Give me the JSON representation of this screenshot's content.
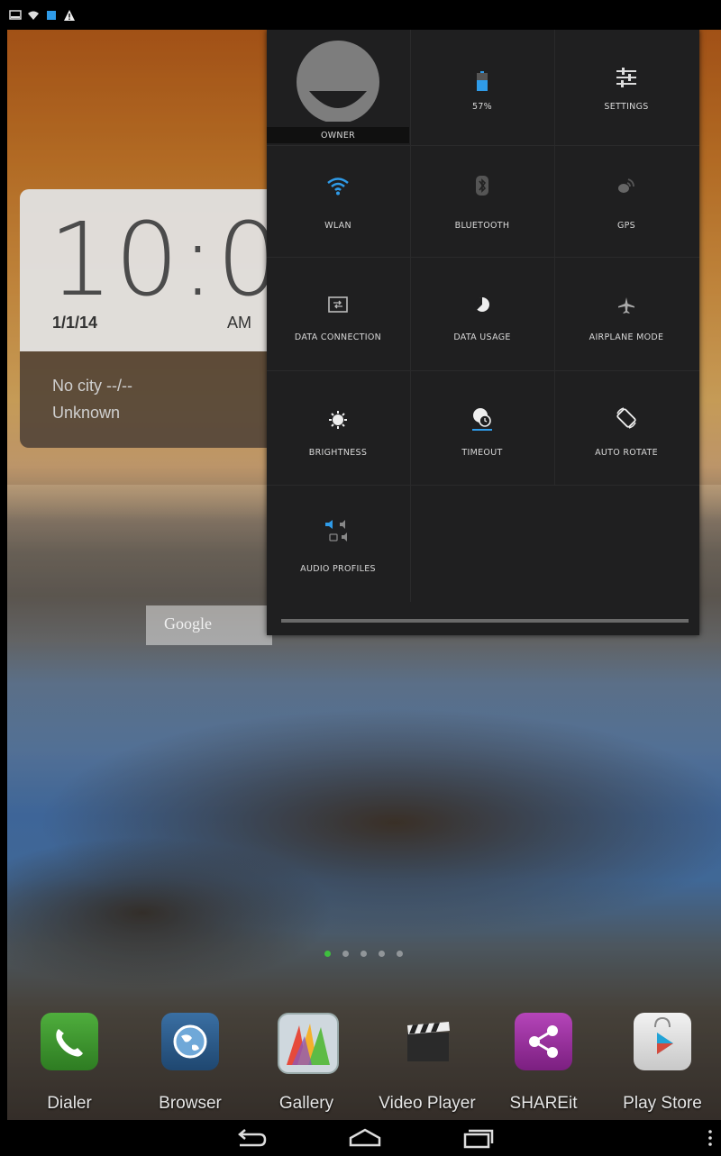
{
  "status_bar": {
    "icons": [
      "screenshot-icon",
      "wifi-signal-icon",
      "notification-icon",
      "warning-icon"
    ]
  },
  "clock_widget": {
    "time": "10:0",
    "date": "1/1/14",
    "ampm": "AM",
    "weather_city": "No city --/--",
    "weather_status": "Unknown"
  },
  "google_bar": {
    "text": "Google"
  },
  "quick_settings": {
    "owner": "OWNER",
    "battery": "57%",
    "settings": "SETTINGS",
    "wlan": "WLAN",
    "bluetooth": "BLUETOOTH",
    "gps": "GPS",
    "data_connection": "DATA CONNECTION",
    "data_usage": "DATA USAGE",
    "airplane_mode": "AIRPLANE MODE",
    "brightness": "BRIGHTNESS",
    "timeout": "TIMEOUT",
    "auto_rotate": "AUTO ROTATE",
    "audio_profiles": "AUDIO PROFILES",
    "colors": {
      "active": "#2f9be8",
      "panel": "#1f1f20",
      "tile_text": "#d8d8d8"
    }
  },
  "dock": {
    "items": [
      {
        "label": "Dialer",
        "icon": "phone-icon",
        "color": "#3a8d2b"
      },
      {
        "label": "Browser",
        "icon": "globe-icon",
        "color": "#2c5b8c"
      },
      {
        "label": "Gallery",
        "icon": "gallery-icon",
        "color": "#7aa7cc"
      },
      {
        "label": "Video Player",
        "icon": "clapperboard-icon",
        "color": "#222222"
      },
      {
        "label": "SHAREit",
        "icon": "share-icon",
        "color": "#8a2a8f"
      },
      {
        "label": "Play Store",
        "icon": "play-store-icon",
        "color": "#d6d6d6"
      }
    ]
  },
  "home_pages": {
    "count": 5,
    "active_index": 0
  },
  "nav_bar": {
    "icons": [
      "back-icon",
      "home-icon",
      "recents-icon",
      "menu-icon"
    ]
  }
}
